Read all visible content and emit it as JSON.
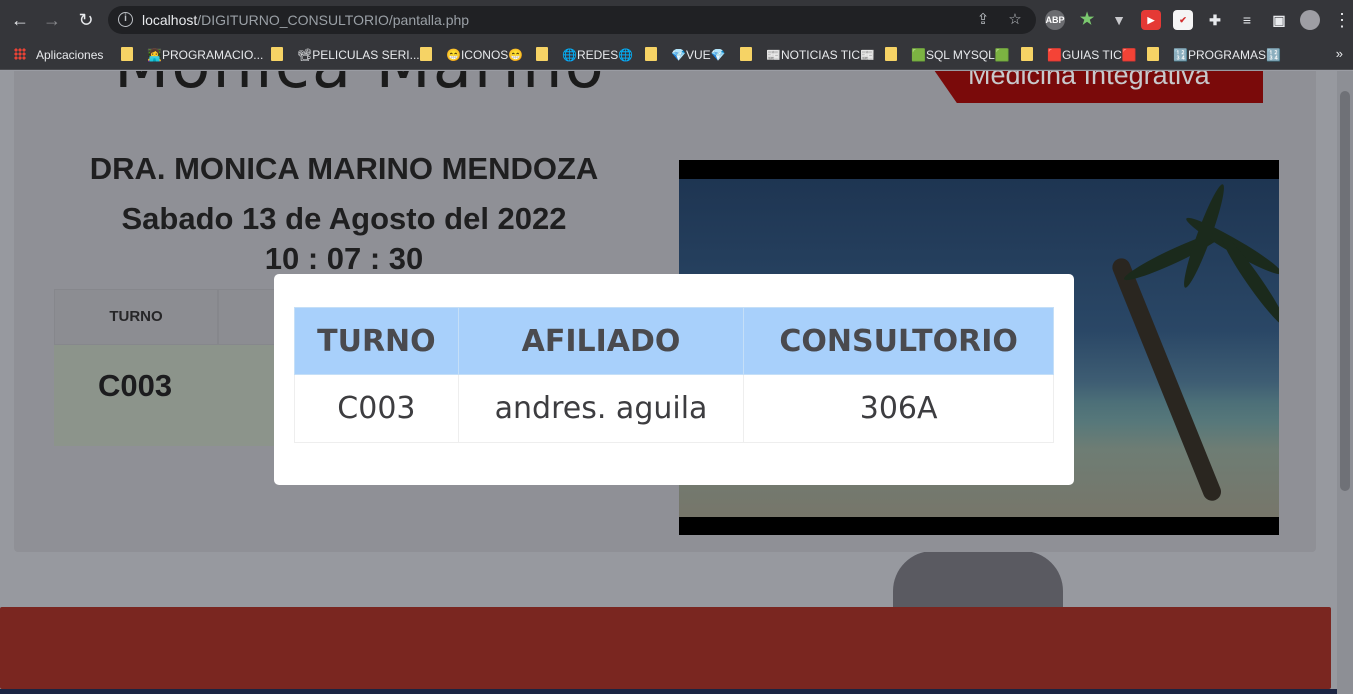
{
  "browser": {
    "url_host": "localhost",
    "url_path": "/DIGITURNO_CONSULTORIO/pantalla.php",
    "extensions": [
      "ABP",
      "★",
      "▼",
      "▶",
      "✔",
      "✚",
      "≡",
      "▣"
    ]
  },
  "bookmarks": {
    "items": [
      {
        "label": "Aplicaciones",
        "icon": "apps-grid-icon"
      },
      {
        "label": "👩‍💻PROGRAMACIO..."
      },
      {
        "label": "📽PELICULAS SERI..."
      },
      {
        "label": "😁ICONOS😁"
      },
      {
        "label": "🌐REDES🌐"
      },
      {
        "label": "💎VUE💎"
      },
      {
        "label": "📰NOTICIAS TIC📰"
      },
      {
        "label": "🟩SQL MYSQL🟩"
      },
      {
        "label": "🟥GUIAS TIC🟥"
      },
      {
        "label": "🔢PROGRAMAS🔢"
      }
    ],
    "more": "»"
  },
  "page": {
    "logo_text": "Monica Marino",
    "banner_text": "Medicina Integrativa",
    "doctor_name": "DRA. MONICA MARINO MENDOZA",
    "date": "Sabado 13 de Agosto del 2022",
    "time": "10 : 07 : 30",
    "background_table": {
      "header": "TURNO",
      "cell": "C003"
    }
  },
  "modal": {
    "headers": [
      "TURNO",
      "AFILIADO",
      "CONSULTORIO"
    ],
    "row": [
      "C003",
      "andres. aguila",
      "306A"
    ]
  },
  "colors": {
    "modal_header_bg": "#a8d0fb",
    "footer_red": "#7a2620",
    "banner_red": "#7a0a0a"
  }
}
